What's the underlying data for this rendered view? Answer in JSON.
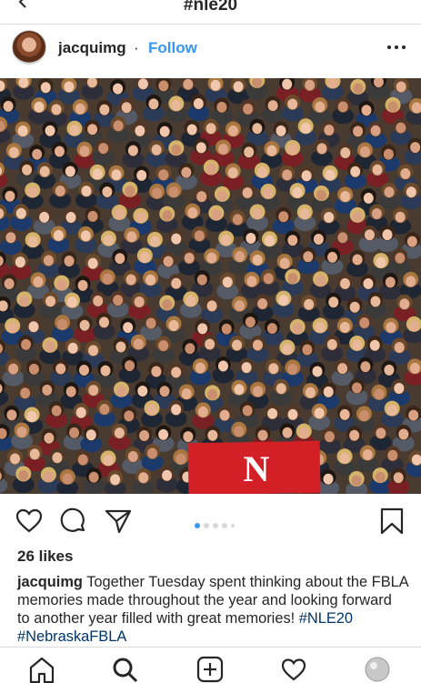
{
  "header": {
    "title": "#nle20",
    "back_icon": "chevron-left-icon"
  },
  "post": {
    "username": "jacquimg",
    "separator": "·",
    "follow_label": "Follow",
    "more_icon": "more-horizontal-icon",
    "banner_letter": "N",
    "likes": "26 likes",
    "caption_user": "jacquimg",
    "caption_text": "Together Tuesday spent thinking about the FBLA memories made throughout the year and looking forward to another year filled with great memories!",
    "hashtags": [
      "#NLE20",
      "#NebraskaFBLA"
    ],
    "carousel": {
      "count": 5,
      "active": 1
    }
  },
  "actions": [
    "heart-icon",
    "comment-icon",
    "share-icon",
    "bookmark-icon"
  ],
  "navbar": [
    "home-icon",
    "search-icon",
    "add-post-icon",
    "activity-heart-icon",
    "profile-avatar-icon"
  ],
  "colors": {
    "accent": "#3897f0",
    "text": "#262626",
    "hashtag": "#003569",
    "banner": "#d32027"
  }
}
